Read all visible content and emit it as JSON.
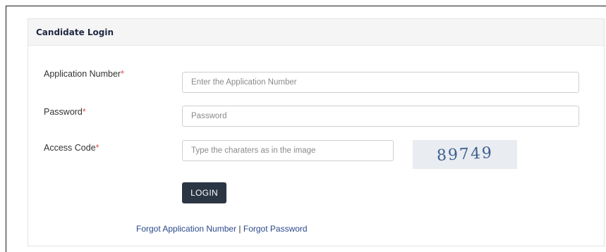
{
  "panel": {
    "title": "Candidate Login"
  },
  "form": {
    "application_number": {
      "label": "Application Number",
      "required_mark": "*",
      "placeholder": "Enter the Application Number",
      "value": ""
    },
    "password": {
      "label": "Password",
      "required_mark": "*",
      "placeholder": "Password",
      "value": ""
    },
    "access_code": {
      "label": "Access Code",
      "required_mark": "*",
      "placeholder": "Type the charaters as in the image",
      "value": ""
    },
    "captcha_text": "89749",
    "login_label": "LOGIN"
  },
  "links": {
    "forgot_application": "Forgot Application Number",
    "separator": " | ",
    "forgot_password": "Forgot Password"
  },
  "colors": {
    "required": "#d9534f",
    "button_bg": "#2b3644",
    "link": "#2a4a8a",
    "header_bg": "#f5f5f5"
  }
}
